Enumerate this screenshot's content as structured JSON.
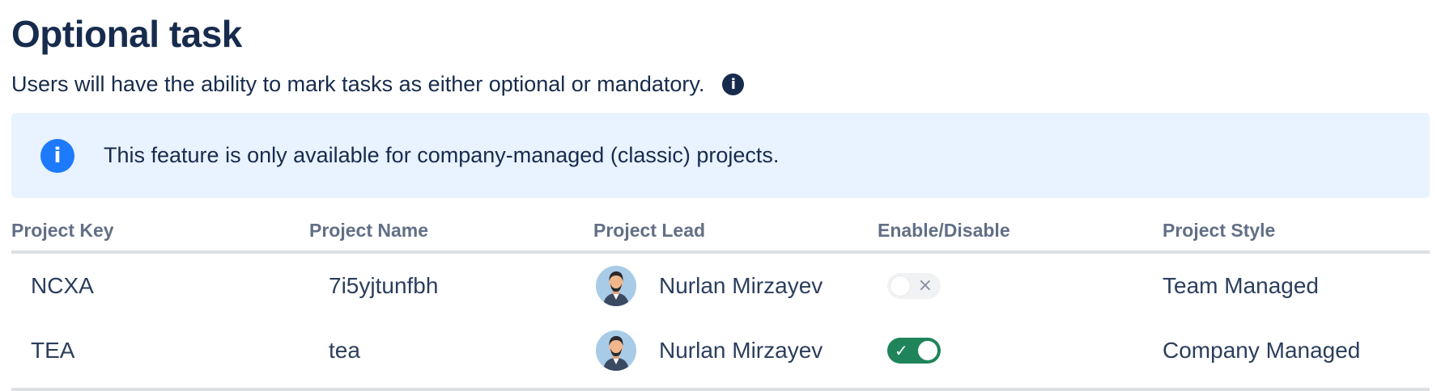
{
  "header": {
    "title": "Optional task",
    "description": "Users will have the ability to mark tasks as either optional or mandatory.",
    "info_icon": "info-icon"
  },
  "banner": {
    "icon": "info-icon",
    "text": "This feature is only available for company-managed (classic) projects.",
    "color": "#e9f2ff",
    "icon_color": "#1d7afc"
  },
  "table": {
    "headers": {
      "key": "Project Key",
      "name": "Project Name",
      "lead": "Project Lead",
      "toggle": "Enable/Disable",
      "style": "Project Style"
    },
    "rows": [
      {
        "key": "NCXA",
        "name": "7i5yjtunfbh",
        "lead": "Nurlan Mirzayev",
        "enabled": false,
        "style": "Team Managed"
      },
      {
        "key": "TEA",
        "name": "tea",
        "lead": "Nurlan Mirzayev",
        "enabled": true,
        "style": "Company Managed"
      }
    ]
  },
  "colors": {
    "toggle_on": "#1f845a",
    "toggle_off": "#f1f2f4",
    "text_primary": "#172b4d",
    "header_text": "#626f86"
  }
}
